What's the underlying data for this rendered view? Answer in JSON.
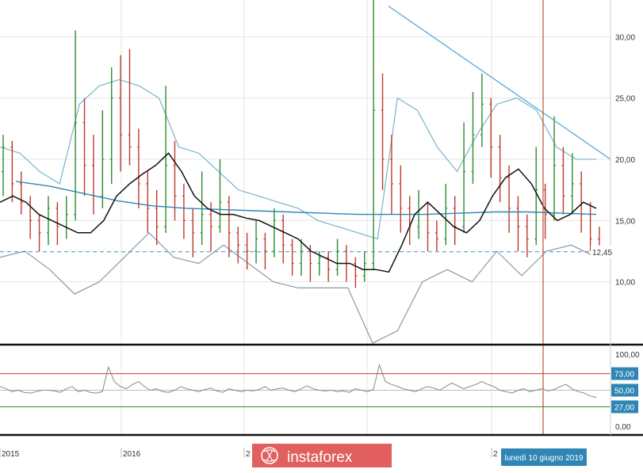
{
  "colors": {
    "background": "#ffffff",
    "grid": "#e6e6e6",
    "candle_up": "#2e8b2e",
    "candle_down": "#c0392b",
    "bollinger": "#7fb9cc",
    "moving_average_long": "#2f86b5",
    "moving_average_short": "#111111",
    "trendline": "#5aa9d6",
    "current_price_line": "#3a8fb7",
    "vertical_marker": "#c0552b",
    "oscillator_line": "#888888",
    "overbought_line": "#c0392b",
    "oversold_line": "#2e8b2e",
    "label_badge": "#2f86b5",
    "watermark_bg": "#e15f5f"
  },
  "watermark": {
    "text": "instaforex",
    "icon": "instaforex-globe-logo"
  },
  "date_label": "lunedì 10 giugno 2019",
  "chart_data": [
    {
      "type": "candlestick",
      "title": "",
      "ylim": [
        5,
        33
      ],
      "y_ticks": [
        "10,00",
        "15,00",
        "20,00",
        "25,00",
        "30,00"
      ],
      "current_price": "12,45",
      "grid": true,
      "indicators": [
        "bollinger-bands",
        "moving-average-short",
        "moving-average-long",
        "trendline"
      ],
      "moving_average_short": [
        16.5,
        17.0,
        16.5,
        15.5,
        15.0,
        14.5,
        14.0,
        14.0,
        15.0,
        17.0,
        18.0,
        18.8,
        19.5,
        20.5,
        19.0,
        17.0,
        16.0,
        15.5,
        15.5,
        15.2,
        15.0,
        14.5,
        14.0,
        13.5,
        12.5,
        12.0,
        11.5,
        11.5,
        11.0,
        11.0,
        10.8,
        13.0,
        15.5,
        16.5,
        15.5,
        14.5,
        14.0,
        15.0,
        17.0,
        18.5,
        19.2,
        18.0,
        16.0,
        15.0,
        15.5,
        16.5,
        16.0
      ],
      "moving_average_long": [
        18.2,
        17.8,
        17.2,
        16.6,
        16.2,
        16.0,
        15.9,
        15.8,
        15.7,
        15.6,
        15.5,
        15.5,
        15.5,
        15.6,
        15.7,
        15.7,
        15.6,
        15.5
      ],
      "bollinger_upper": [
        21.0,
        20.5,
        19.0,
        18.0,
        24.5,
        26.0,
        26.5,
        26.0,
        25.0,
        21.0,
        20.5,
        19.0,
        17.5,
        17.0,
        16.5,
        16.0,
        15.0,
        14.5,
        14.0,
        13.5,
        25.0,
        24.0,
        21.0,
        19.0,
        22.0,
        24.5,
        25.0,
        24.0,
        21.0,
        20.0,
        20.0
      ],
      "bollinger_lower": [
        12.0,
        12.5,
        11.0,
        9.0,
        10.0,
        12.0,
        14.0,
        12.0,
        11.5,
        13.0,
        11.5,
        10.0,
        9.5,
        9.5,
        9.5,
        5.0,
        6.0,
        10.0,
        11.0,
        10.0,
        12.5,
        10.5,
        12.5,
        13.0,
        12.0
      ],
      "trendline": {
        "start": 32.5,
        "end": 20.0
      },
      "candles": [
        {
          "o": 19.0,
          "c": 21.0,
          "h": 22.0,
          "l": 17.0
        },
        {
          "o": 21.0,
          "c": 18.0,
          "h": 21.5,
          "l": 16.5
        },
        {
          "o": 18.0,
          "c": 16.5,
          "h": 19.0,
          "l": 15.5
        },
        {
          "o": 16.5,
          "c": 15.0,
          "h": 17.0,
          "l": 13.5
        },
        {
          "o": 15.0,
          "c": 14.0,
          "h": 15.5,
          "l": 12.5
        },
        {
          "o": 14.0,
          "c": 16.0,
          "h": 17.0,
          "l": 13.0
        },
        {
          "o": 16.0,
          "c": 14.5,
          "h": 16.5,
          "l": 13.0
        },
        {
          "o": 14.5,
          "c": 15.5,
          "h": 17.0,
          "l": 13.5
        },
        {
          "o": 15.5,
          "c": 23.0,
          "h": 30.5,
          "l": 15.0
        },
        {
          "o": 23.0,
          "c": 19.5,
          "h": 25.0,
          "l": 17.0
        },
        {
          "o": 19.5,
          "c": 17.0,
          "h": 22.0,
          "l": 15.5
        },
        {
          "o": 17.0,
          "c": 20.0,
          "h": 24.0,
          "l": 16.0
        },
        {
          "o": 20.0,
          "c": 25.0,
          "h": 27.5,
          "l": 18.0
        },
        {
          "o": 25.0,
          "c": 22.0,
          "h": 28.5,
          "l": 19.0
        },
        {
          "o": 22.0,
          "c": 21.0,
          "h": 29.0,
          "l": 19.5
        },
        {
          "o": 21.0,
          "c": 18.0,
          "h": 22.5,
          "l": 16.0
        },
        {
          "o": 18.0,
          "c": 16.0,
          "h": 19.0,
          "l": 14.0
        },
        {
          "o": 16.0,
          "c": 14.5,
          "h": 17.5,
          "l": 13.0
        },
        {
          "o": 14.5,
          "c": 19.5,
          "h": 26.0,
          "l": 14.0
        },
        {
          "o": 19.5,
          "c": 17.0,
          "h": 21.5,
          "l": 15.0
        },
        {
          "o": 17.0,
          "c": 15.0,
          "h": 18.0,
          "l": 13.5
        },
        {
          "o": 15.0,
          "c": 14.0,
          "h": 16.0,
          "l": 12.0
        },
        {
          "o": 14.0,
          "c": 15.5,
          "h": 19.0,
          "l": 13.0
        },
        {
          "o": 15.5,
          "c": 14.5,
          "h": 16.5,
          "l": 12.5
        },
        {
          "o": 14.5,
          "c": 16.5,
          "h": 20.0,
          "l": 14.0
        },
        {
          "o": 16.5,
          "c": 14.0,
          "h": 17.0,
          "l": 12.0
        },
        {
          "o": 14.0,
          "c": 13.0,
          "h": 14.5,
          "l": 11.5
        },
        {
          "o": 13.0,
          "c": 12.5,
          "h": 14.0,
          "l": 11.0
        },
        {
          "o": 12.5,
          "c": 13.5,
          "h": 15.0,
          "l": 11.5
        },
        {
          "o": 13.5,
          "c": 12.5,
          "h": 14.0,
          "l": 11.0
        },
        {
          "o": 12.5,
          "c": 15.0,
          "h": 16.0,
          "l": 12.0
        },
        {
          "o": 15.0,
          "c": 13.0,
          "h": 15.5,
          "l": 11.5
        },
        {
          "o": 13.0,
          "c": 11.5,
          "h": 13.5,
          "l": 10.5
        },
        {
          "o": 11.5,
          "c": 12.5,
          "h": 13.5,
          "l": 10.5
        },
        {
          "o": 12.5,
          "c": 11.5,
          "h": 13.0,
          "l": 10.0
        },
        {
          "o": 11.5,
          "c": 12.0,
          "h": 12.5,
          "l": 10.5
        },
        {
          "o": 12.0,
          "c": 11.0,
          "h": 12.5,
          "l": 10.0
        },
        {
          "o": 11.0,
          "c": 12.5,
          "h": 13.5,
          "l": 10.5
        },
        {
          "o": 12.5,
          "c": 11.5,
          "h": 13.0,
          "l": 10.0
        },
        {
          "o": 11.5,
          "c": 10.5,
          "h": 12.0,
          "l": 9.5
        },
        {
          "o": 10.5,
          "c": 11.5,
          "h": 12.5,
          "l": 10.0
        },
        {
          "o": 11.5,
          "c": 24.0,
          "h": 33.0,
          "l": 11.0
        },
        {
          "o": 24.0,
          "c": 20.0,
          "h": 27.0,
          "l": 17.5
        },
        {
          "o": 20.0,
          "c": 18.0,
          "h": 22.0,
          "l": 15.5
        },
        {
          "o": 18.0,
          "c": 16.0,
          "h": 19.5,
          "l": 14.0
        },
        {
          "o": 16.0,
          "c": 14.5,
          "h": 17.0,
          "l": 13.0
        },
        {
          "o": 14.5,
          "c": 15.5,
          "h": 17.5,
          "l": 13.5
        },
        {
          "o": 15.5,
          "c": 14.0,
          "h": 16.5,
          "l": 12.5
        },
        {
          "o": 14.0,
          "c": 13.5,
          "h": 15.0,
          "l": 12.5
        },
        {
          "o": 13.5,
          "c": 16.0,
          "h": 18.0,
          "l": 13.0
        },
        {
          "o": 16.0,
          "c": 14.5,
          "h": 17.0,
          "l": 13.0
        },
        {
          "o": 14.5,
          "c": 19.0,
          "h": 23.0,
          "l": 14.0
        },
        {
          "o": 19.0,
          "c": 22.0,
          "h": 25.5,
          "l": 18.0
        },
        {
          "o": 22.0,
          "c": 24.5,
          "h": 27.0,
          "l": 21.0
        },
        {
          "o": 24.5,
          "c": 21.0,
          "h": 25.0,
          "l": 18.5
        },
        {
          "o": 21.0,
          "c": 18.5,
          "h": 22.0,
          "l": 16.5
        },
        {
          "o": 18.5,
          "c": 16.0,
          "h": 19.5,
          "l": 14.0
        },
        {
          "o": 16.0,
          "c": 14.5,
          "h": 17.0,
          "l": 12.5
        },
        {
          "o": 14.5,
          "c": 13.5,
          "h": 15.5,
          "l": 12.0
        },
        {
          "o": 13.5,
          "c": 17.5,
          "h": 21.0,
          "l": 13.0
        },
        {
          "o": 17.5,
          "c": 15.5,
          "h": 18.0,
          "l": 13.5
        },
        {
          "o": 15.5,
          "c": 19.5,
          "h": 23.5,
          "l": 15.0
        },
        {
          "o": 19.5,
          "c": 17.0,
          "h": 21.0,
          "l": 15.5
        },
        {
          "o": 17.0,
          "c": 18.0,
          "h": 20.5,
          "l": 15.5
        },
        {
          "o": 18.0,
          "c": 15.5,
          "h": 19.0,
          "l": 14.0
        },
        {
          "o": 15.5,
          "c": 13.5,
          "h": 16.5,
          "l": 12.5
        },
        {
          "o": 13.5,
          "c": 12.5,
          "h": 14.5,
          "l": 12.0
        }
      ]
    },
    {
      "type": "line",
      "title": "",
      "ylim": [
        0,
        100
      ],
      "y_ticks": [
        "0,00",
        "100,00"
      ],
      "levels": [
        "27,00",
        "50,00",
        "73,00"
      ],
      "series": [
        {
          "values": [
            55,
            52,
            48,
            50,
            47,
            46,
            48,
            50,
            50,
            49,
            47,
            52,
            55,
            48,
            50,
            47,
            46,
            48,
            82,
            62,
            55,
            52,
            58,
            62,
            55,
            50,
            52,
            48,
            47,
            50,
            55,
            52,
            50,
            48,
            51,
            53,
            49,
            47,
            52,
            50,
            48,
            50,
            49,
            51,
            55,
            50,
            52,
            53,
            50,
            48,
            52,
            56,
            52,
            50,
            49,
            50,
            48,
            49,
            47,
            52,
            50,
            48,
            51,
            85,
            62,
            58,
            55,
            52,
            50,
            48,
            52,
            55,
            53,
            50,
            55,
            60,
            56,
            52,
            55,
            58,
            62,
            58,
            55,
            50,
            48,
            46,
            50,
            52,
            48,
            50,
            52,
            49,
            51,
            55,
            58,
            52,
            48,
            46,
            42,
            40
          ]
        }
      ]
    }
  ],
  "x_axis": {
    "labels": [
      "2015",
      "2016",
      "2",
      "2"
    ]
  }
}
